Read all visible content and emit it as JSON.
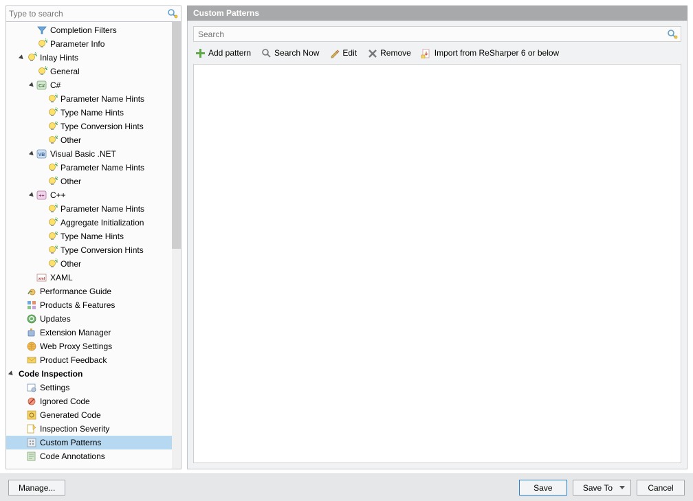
{
  "sidebar": {
    "search_placeholder": "Type to search",
    "items": [
      {
        "indent": 3,
        "exp": "none",
        "icon": "filter",
        "label": "Completion Filters",
        "sel": false
      },
      {
        "indent": 3,
        "exp": "none",
        "icon": "bulb",
        "label": "Parameter Info",
        "sel": false
      },
      {
        "indent": 2,
        "exp": "open",
        "icon": "bulb",
        "label": "Inlay Hints",
        "sel": false
      },
      {
        "indent": 3,
        "exp": "none",
        "icon": "bulb",
        "label": "General",
        "sel": false
      },
      {
        "indent": 3,
        "exp": "open",
        "icon": "cs",
        "label": "C#",
        "sel": false
      },
      {
        "indent": 4,
        "exp": "none",
        "icon": "bulb",
        "label": "Parameter Name Hints",
        "sel": false
      },
      {
        "indent": 4,
        "exp": "none",
        "icon": "bulb",
        "label": "Type Name Hints",
        "sel": false
      },
      {
        "indent": 4,
        "exp": "none",
        "icon": "bulb",
        "label": "Type Conversion Hints",
        "sel": false
      },
      {
        "indent": 4,
        "exp": "none",
        "icon": "bulb",
        "label": "Other",
        "sel": false
      },
      {
        "indent": 3,
        "exp": "open",
        "icon": "vb",
        "label": "Visual Basic .NET",
        "sel": false
      },
      {
        "indent": 4,
        "exp": "none",
        "icon": "bulb",
        "label": "Parameter Name Hints",
        "sel": false
      },
      {
        "indent": 4,
        "exp": "none",
        "icon": "bulb",
        "label": "Other",
        "sel": false
      },
      {
        "indent": 3,
        "exp": "open",
        "icon": "cpp",
        "label": "C++",
        "sel": false
      },
      {
        "indent": 4,
        "exp": "none",
        "icon": "bulb",
        "label": "Parameter Name Hints",
        "sel": false
      },
      {
        "indent": 4,
        "exp": "none",
        "icon": "bulb",
        "label": "Aggregate Initialization",
        "sel": false
      },
      {
        "indent": 4,
        "exp": "none",
        "icon": "bulb",
        "label": "Type Name Hints",
        "sel": false
      },
      {
        "indent": 4,
        "exp": "none",
        "icon": "bulb",
        "label": "Type Conversion Hints",
        "sel": false
      },
      {
        "indent": 4,
        "exp": "none",
        "icon": "bulb",
        "label": "Other",
        "sel": false
      },
      {
        "indent": 3,
        "exp": "none",
        "icon": "xaml",
        "label": "XAML",
        "sel": false
      },
      {
        "indent": 2,
        "exp": "none",
        "icon": "snail",
        "label": "Performance Guide",
        "sel": false
      },
      {
        "indent": 2,
        "exp": "none",
        "icon": "products",
        "label": "Products & Features",
        "sel": false
      },
      {
        "indent": 2,
        "exp": "none",
        "icon": "updates",
        "label": "Updates",
        "sel": false
      },
      {
        "indent": 2,
        "exp": "none",
        "icon": "ext",
        "label": "Extension Manager",
        "sel": false
      },
      {
        "indent": 2,
        "exp": "none",
        "icon": "proxy",
        "label": "Web Proxy Settings",
        "sel": false
      },
      {
        "indent": 2,
        "exp": "none",
        "icon": "mail",
        "label": "Product Feedback",
        "sel": false
      },
      {
        "indent": 1,
        "exp": "open",
        "icon": "",
        "label": "Code Inspection",
        "sel": false,
        "bold": true
      },
      {
        "indent": 2,
        "exp": "none",
        "icon": "settings",
        "label": "Settings",
        "sel": false
      },
      {
        "indent": 2,
        "exp": "none",
        "icon": "ignored",
        "label": "Ignored Code",
        "sel": false
      },
      {
        "indent": 2,
        "exp": "none",
        "icon": "gen",
        "label": "Generated Code",
        "sel": false
      },
      {
        "indent": 2,
        "exp": "none",
        "icon": "severity",
        "label": "Inspection Severity",
        "sel": false
      },
      {
        "indent": 2,
        "exp": "none",
        "icon": "patterns",
        "label": "Custom Patterns",
        "sel": true
      },
      {
        "indent": 2,
        "exp": "none",
        "icon": "annot",
        "label": "Code Annotations",
        "sel": false
      }
    ]
  },
  "content": {
    "title": "Custom Patterns",
    "search_placeholder": "Search",
    "toolbar": {
      "add": "Add pattern",
      "search": "Search Now",
      "edit": "Edit",
      "remove": "Remove",
      "import": "Import from ReSharper 6 or below"
    }
  },
  "bottom": {
    "manage": "Manage...",
    "save": "Save",
    "saveto": "Save To",
    "cancel": "Cancel"
  }
}
